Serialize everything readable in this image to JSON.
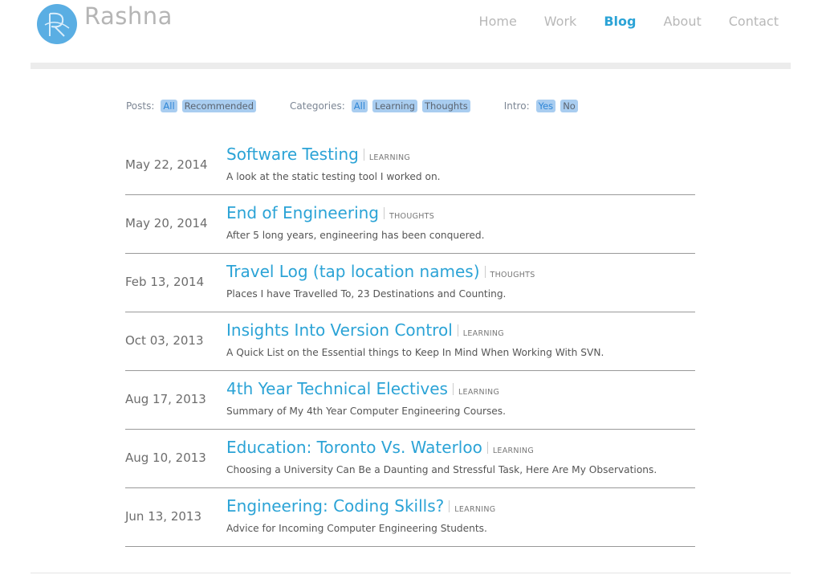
{
  "brand": {
    "name": "Rashna",
    "logo_color": "#5aaee3",
    "accent": "#2ba3d6"
  },
  "nav": [
    {
      "label": "Home",
      "active": false
    },
    {
      "label": "Work",
      "active": false
    },
    {
      "label": "Blog",
      "active": true
    },
    {
      "label": "About",
      "active": false
    },
    {
      "label": "Contact",
      "active": false
    }
  ],
  "filters": {
    "posts": {
      "label": "Posts:",
      "options": [
        "All",
        "Recommended"
      ]
    },
    "categories": {
      "label": "Categories:",
      "options": [
        "All",
        "Learning",
        "Thoughts"
      ]
    },
    "intro": {
      "label": "Intro:",
      "options": [
        "Yes",
        "No"
      ]
    }
  },
  "posts": [
    {
      "date": "May 22, 2014",
      "title": "Software Testing",
      "category": "LEARNING",
      "description": "A look at the static testing tool I worked on."
    },
    {
      "date": "May 20, 2014",
      "title": "End of Engineering",
      "category": "THOUGHTS",
      "description": "After 5 long years, engineering has been conquered."
    },
    {
      "date": "Feb 13, 2014",
      "title": "Travel Log (tap location names)",
      "category": "THOUGHTS",
      "description": "Places I have Travelled To, 23 Destinations and Counting."
    },
    {
      "date": "Oct 03, 2013",
      "title": "Insights Into Version Control",
      "category": "LEARNING",
      "description": "A Quick List on the Essential things to Keep In Mind When Working With SVN."
    },
    {
      "date": "Aug 17, 2013",
      "title": "4th Year Technical Electives",
      "category": "LEARNING",
      "description": "Summary of My 4th Year Computer Engineering Courses."
    },
    {
      "date": "Aug 10, 2013",
      "title": "Education: Toronto Vs. Waterloo",
      "category": "LEARNING",
      "description": "Choosing a University Can Be a Daunting and Stressful Task, Here Are My Observations."
    },
    {
      "date": "Jun 13, 2013",
      "title": "Engineering: Coding Skills?",
      "category": "LEARNING",
      "description": "Advice for Incoming Computer Engineering Students."
    }
  ]
}
